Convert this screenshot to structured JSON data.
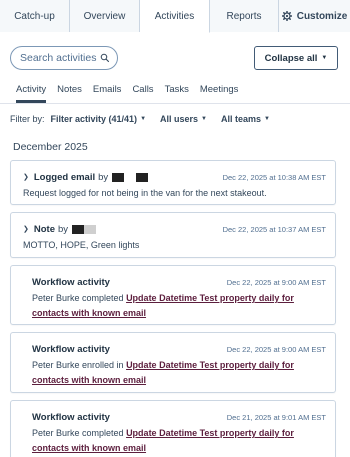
{
  "tabs": [
    {
      "label": "Catch-up",
      "active": false
    },
    {
      "label": "Overview",
      "active": false
    },
    {
      "label": "Activities",
      "active": true
    },
    {
      "label": "Reports",
      "active": false
    }
  ],
  "customize": {
    "label": "Customize",
    "icon": "gear-icon"
  },
  "search": {
    "placeholder": "Search activities",
    "icon": "search-icon"
  },
  "collapse_button": {
    "label": "Collapse all",
    "icon": "caret-down-icon"
  },
  "subtabs": [
    {
      "label": "Activity",
      "active": true
    },
    {
      "label": "Notes",
      "active": false
    },
    {
      "label": "Emails",
      "active": false
    },
    {
      "label": "Calls",
      "active": false
    },
    {
      "label": "Tasks",
      "active": false
    },
    {
      "label": "Meetings",
      "active": false
    }
  ],
  "filters": {
    "label": "Filter by:",
    "activity": "Filter activity (41/41)",
    "users": "All users",
    "teams": "All teams"
  },
  "month": "December 2025",
  "cards": [
    {
      "type": "email",
      "title": "Logged email",
      "by": "by",
      "timestamp": "Dec 22, 2025 at 10:38 AM EST",
      "body": "Request logged for not being in the van for the next stakeout."
    },
    {
      "type": "note",
      "title": "Note",
      "by": "by",
      "timestamp": "Dec 22, 2025 at 10:37 AM EST",
      "body": "MOTTO, HOPE, Green lights"
    },
    {
      "type": "workflow",
      "title": "Workflow activity",
      "timestamp": "Dec 22, 2025 at 9:00 AM EST",
      "actor": "Peter Burke completed ",
      "link": "Update Datetime Test property daily for contacts with known email"
    },
    {
      "type": "workflow",
      "title": "Workflow activity",
      "timestamp": "Dec 22, 2025 at 9:00 AM EST",
      "actor": "Peter Burke enrolled in ",
      "link": "Update Datetime Test property daily for contacts with known email"
    },
    {
      "type": "workflow",
      "title": "Workflow activity",
      "timestamp": "Dec 21, 2025 at 9:01 AM EST",
      "actor": "Peter Burke completed ",
      "link": "Update Datetime Test property daily for contacts with known email"
    }
  ],
  "colors": {
    "text": "#33475b",
    "border": "#cbd6e2",
    "link": "#5c1e3d",
    "tabbar": "#f5f8fa"
  }
}
